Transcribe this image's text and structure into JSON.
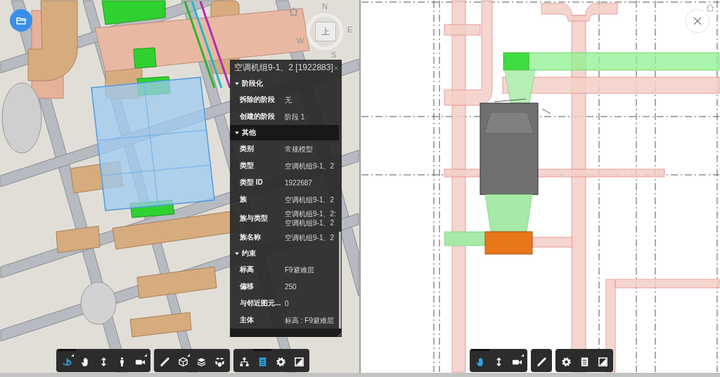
{
  "viewer_3d": {
    "viewcube": {
      "face": "上",
      "compass": [
        "N",
        "E",
        "S",
        "W"
      ]
    },
    "properties_panel": {
      "title": "空调机组9-1、2 [1922883]",
      "sections": [
        {
          "name": "阶段化",
          "expanded": true,
          "selected": false,
          "rows": [
            {
              "label": "拆除的阶段",
              "value": "无"
            },
            {
              "label": "创建的阶段",
              "value": "阶段 1"
            }
          ]
        },
        {
          "name": "其他",
          "expanded": true,
          "selected": true,
          "rows": [
            {
              "label": "类别",
              "value": "常规模型"
            },
            {
              "label": "类型",
              "value": "空调机组9-1、2"
            },
            {
              "label": "类型 ID",
              "value": "1922687"
            },
            {
              "label": "族",
              "value": "空调机组9-1、2"
            },
            {
              "label": "族与类型",
              "value": "空调机组9-1、2: 空调机组9-1、2"
            },
            {
              "label": "族名称",
              "value": "空调机组9-1、2"
            }
          ]
        },
        {
          "name": "约束",
          "expanded": true,
          "selected": false,
          "rows": [
            {
              "label": "标高",
              "value": "F9避难层"
            },
            {
              "label": "偏移",
              "value": "250"
            },
            {
              "label": "与邻近图元...",
              "value": "0"
            },
            {
              "label": "主体",
              "value": "标高 : F9避难层"
            }
          ]
        }
      ]
    },
    "toolbar": {
      "groups": [
        {
          "tools": [
            {
              "kind": "orbit",
              "selected": true,
              "has_menu": true
            },
            {
              "kind": "pan",
              "selected": false,
              "has_menu": false
            },
            {
              "kind": "zoom",
              "selected": false,
              "has_menu": false
            },
            {
              "kind": "walk",
              "selected": false,
              "has_menu": false
            },
            {
              "kind": "camera",
              "selected": false,
              "has_menu": true
            }
          ]
        },
        {
          "tools": [
            {
              "kind": "measure",
              "selected": false,
              "has_menu": false
            },
            {
              "kind": "section",
              "selected": false,
              "has_menu": true
            },
            {
              "kind": "layers",
              "selected": false,
              "has_menu": false
            },
            {
              "kind": "explode",
              "selected": false,
              "has_menu": false
            }
          ]
        },
        {
          "tools": [
            {
              "kind": "tree",
              "selected": false,
              "has_menu": false
            },
            {
              "kind": "properties",
              "selected": true,
              "has_menu": false
            },
            {
              "kind": "settings",
              "selected": false,
              "has_menu": false
            },
            {
              "kind": "fullscreen",
              "selected": false,
              "has_menu": false
            }
          ]
        }
      ]
    }
  },
  "viewer_2d": {
    "toolbar": {
      "groups": [
        {
          "tools": [
            {
              "kind": "pan",
              "selected": true,
              "has_menu": false
            },
            {
              "kind": "zoom",
              "selected": false,
              "has_menu": false
            },
            {
              "kind": "camera",
              "selected": false,
              "has_menu": true
            }
          ]
        },
        {
          "tools": [
            {
              "kind": "measure",
              "selected": false,
              "has_menu": false
            }
          ]
        },
        {
          "tools": [
            {
              "kind": "settings",
              "selected": false,
              "has_menu": false
            },
            {
              "kind": "properties",
              "selected": false,
              "has_menu": false
            },
            {
              "kind": "fullscreen",
              "selected": false,
              "has_menu": false
            }
          ]
        }
      ]
    }
  }
}
